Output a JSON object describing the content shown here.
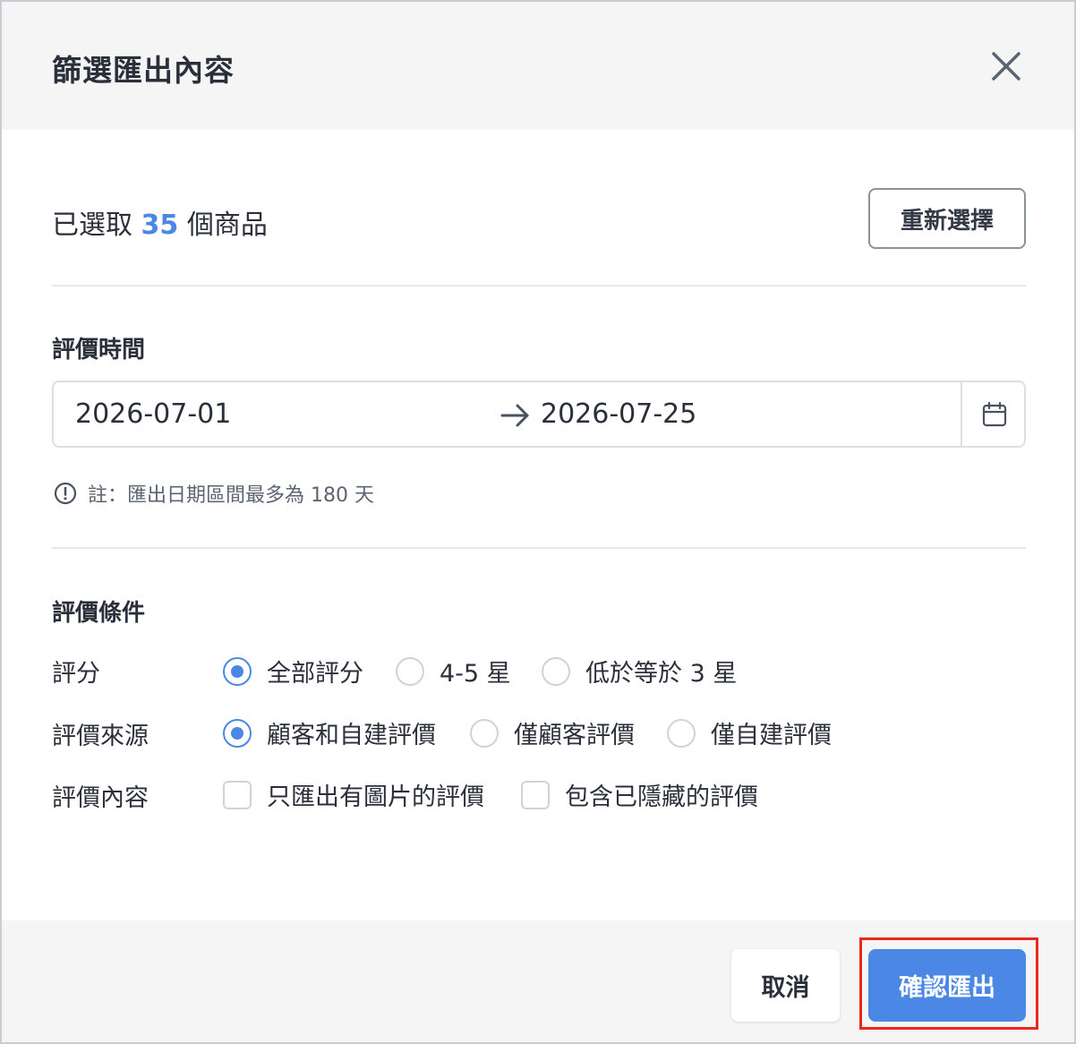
{
  "dialog": {
    "title": "篩選匯出內容"
  },
  "selection": {
    "prefix": "已選取",
    "count": "35",
    "suffix": "個商品",
    "reselect_label": "重新選擇"
  },
  "review_time": {
    "label": "評價時間",
    "start_date": "2026-07-01",
    "end_date": "2026-07-25",
    "note": "註：匯出日期區間最多為 180 天"
  },
  "review_conditions": {
    "label": "評價條件",
    "rating": {
      "label": "評分",
      "options": [
        "全部評分",
        "4-5 星",
        "低於等於 3 星"
      ],
      "selected": "全部評分"
    },
    "source": {
      "label": "評價來源",
      "options": [
        "顧客和自建評價",
        "僅顧客評價",
        "僅自建評價"
      ],
      "selected": "顧客和自建評價"
    },
    "content": {
      "label": "評價內容",
      "options": [
        "只匯出有圖片的評價",
        "包含已隱藏的評價"
      ],
      "checked": []
    }
  },
  "footer": {
    "cancel_label": "取消",
    "confirm_label": "確認匯出"
  },
  "colors": {
    "accent": "#4b87e5",
    "highlight_outline": "#e8291c",
    "header_bg": "#f5f5f6"
  },
  "icons": {
    "close": "close-icon",
    "arrow": "arrow-right-icon",
    "calendar": "calendar-icon",
    "info": "info-icon"
  }
}
